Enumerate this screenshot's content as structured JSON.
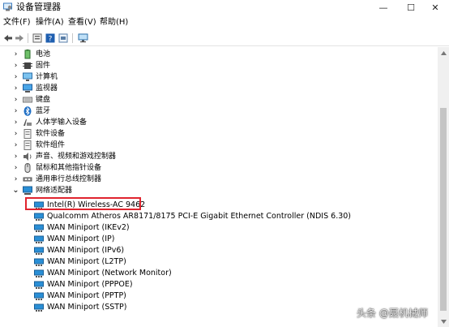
{
  "window": {
    "title": "设备管理器",
    "min_glyph": "—",
    "max_glyph": "☐",
    "close_glyph": "✕"
  },
  "menu": [
    "文件(F)",
    "操作(A)",
    "查看(V)",
    "帮助(H)"
  ],
  "tree": {
    "categories": [
      {
        "label": "电池",
        "icon": "battery-icon",
        "expanded": false
      },
      {
        "label": "固件",
        "icon": "firmware-icon",
        "expanded": false
      },
      {
        "label": "计算机",
        "icon": "computer-icon",
        "expanded": false
      },
      {
        "label": "监视器",
        "icon": "monitor-icon",
        "expanded": false
      },
      {
        "label": "键盘",
        "icon": "keyboard-icon",
        "expanded": false
      },
      {
        "label": "蓝牙",
        "icon": "bluetooth-icon",
        "expanded": false
      },
      {
        "label": "人体学输入设备",
        "icon": "hid-icon",
        "expanded": false
      },
      {
        "label": "软件设备",
        "icon": "software-device-icon",
        "expanded": false
      },
      {
        "label": "软件组件",
        "icon": "software-component-icon",
        "expanded": false
      },
      {
        "label": "声音、视频和游戏控制器",
        "icon": "sound-icon",
        "expanded": false
      },
      {
        "label": "鼠标和其他指针设备",
        "icon": "mouse-icon",
        "expanded": false
      },
      {
        "label": "通用串行总线控制器",
        "icon": "usb-icon",
        "expanded": false
      },
      {
        "label": "网络适配器",
        "icon": "network-adapter-icon",
        "expanded": true
      }
    ],
    "network_adapters": [
      "Intel(R) Wireless-AC 9462",
      "Qualcomm Atheros AR8171/8175 PCI-E Gigabit Ethernet Controller (NDIS 6.30)",
      "WAN Miniport (IKEv2)",
      "WAN Miniport (IP)",
      "WAN Miniport (IPv6)",
      "WAN Miniport (L2TP)",
      "WAN Miniport (Network Monitor)",
      "WAN Miniport (PPPOE)",
      "WAN Miniport (PPTP)",
      "WAN Miniport (SSTP)"
    ],
    "highlighted_adapter": "Intel(R) Wireless-AC 9462"
  },
  "watermark": "头条 @聂机械师",
  "colors": {
    "highlight_border": "#e0242e",
    "network_icon": "#2a8fd6"
  }
}
